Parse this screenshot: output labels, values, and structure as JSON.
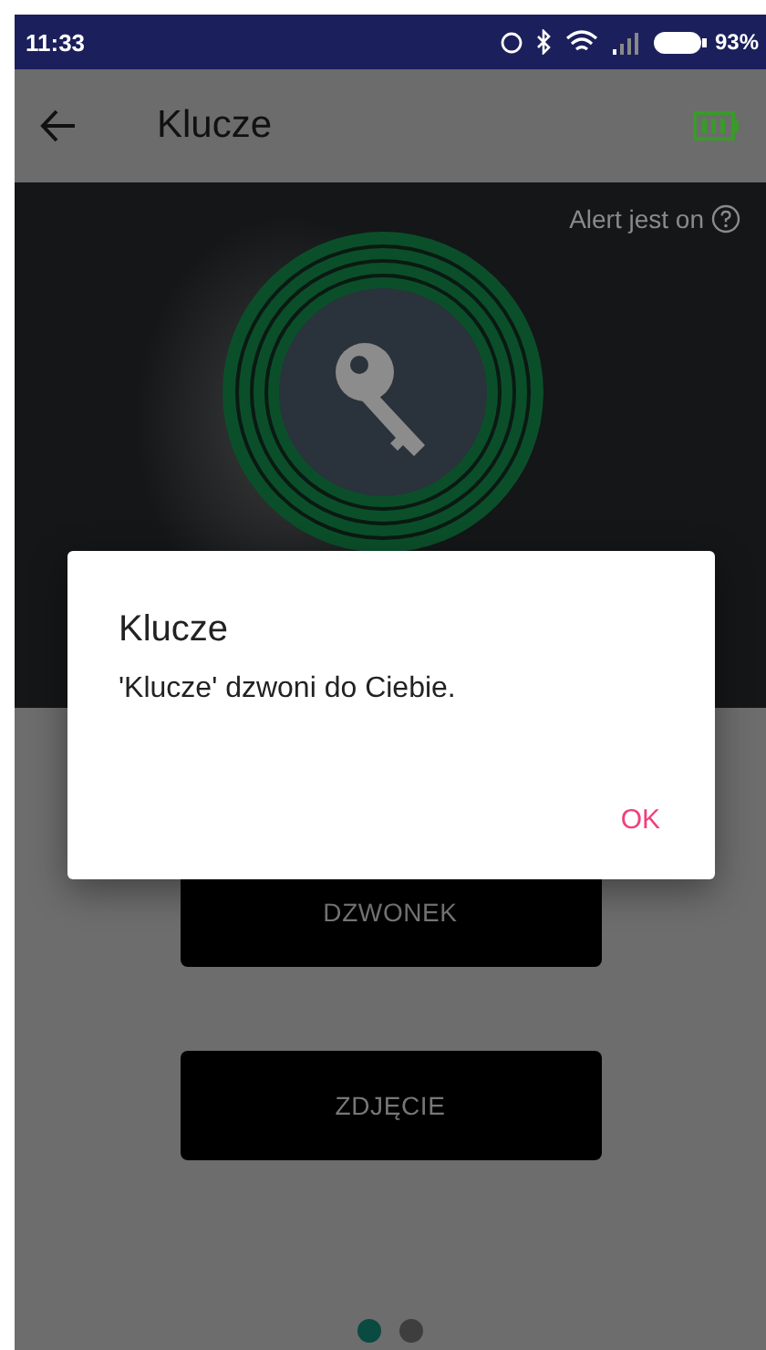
{
  "status_bar": {
    "time": "11:33",
    "battery": "93%"
  },
  "app_bar": {
    "title": "Klucze"
  },
  "alert": {
    "label": "Alert jest on"
  },
  "actions": [
    {
      "label": "DZWONEK"
    },
    {
      "label": "ZDJĘCIE"
    }
  ],
  "pager": [
    {
      "selected": true
    },
    {
      "selected": false
    }
  ],
  "dialog": {
    "title": "Klucze",
    "message": "'Klucze' dzwoni do Ciebie.",
    "button": "OK"
  }
}
